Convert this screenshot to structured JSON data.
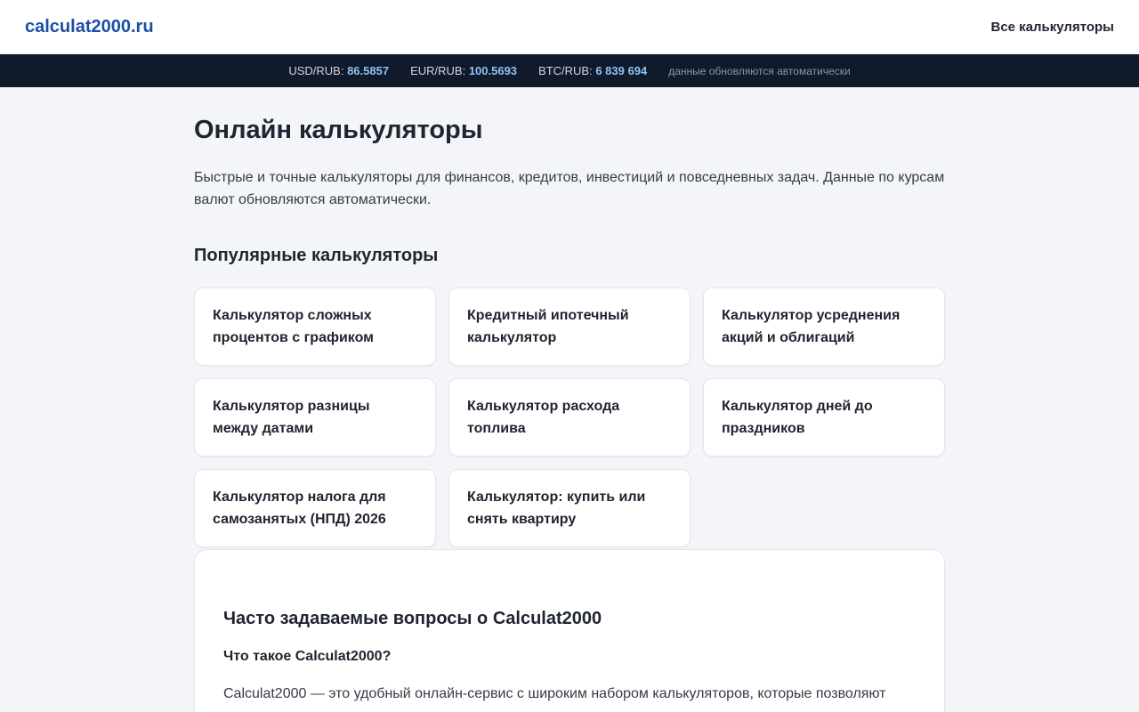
{
  "header": {
    "logo": "calculat2000.ru",
    "nav_all": "Все калькуляторы"
  },
  "ticker": {
    "rates": [
      {
        "label": "USD/RUB:",
        "value": "86.5857"
      },
      {
        "label": "EUR/RUB:",
        "value": "100.5693"
      },
      {
        "label": "BTC/RUB:",
        "value": "6 839 694"
      }
    ],
    "note": "данные обновляются автоматически"
  },
  "main": {
    "title": "Онлайн калькуляторы",
    "intro": "Быстрые и точные калькуляторы для финансов, кредитов, инвестиций и повседневных задач. Данные по курсам валют обновляются автоматически.",
    "popular_title": "Популярные калькуляторы",
    "cards": [
      {
        "label": "Калькулятор сложных процентов с графиком"
      },
      {
        "label": "Кредитный ипотечный калькулятор"
      },
      {
        "label": "Калькулятор усреднения акций и облигаций"
      },
      {
        "label": "Калькулятор разницы между датами"
      },
      {
        "label": "Калькулятор расхода топлива"
      },
      {
        "label": "Калькулятор дней до праздников"
      },
      {
        "label": "Калькулятор налога для самозанятых (НПД) 2026"
      },
      {
        "label": "Калькулятор: купить или снять квартиру"
      }
    ]
  },
  "faq": {
    "title": "Часто задаваемые вопросы о Calculat2000",
    "question": "Что такое Calculat2000?",
    "answer": "Calculat2000 — это удобный онлайн-сервис с широким набором калькуляторов, которые позволяют"
  }
}
